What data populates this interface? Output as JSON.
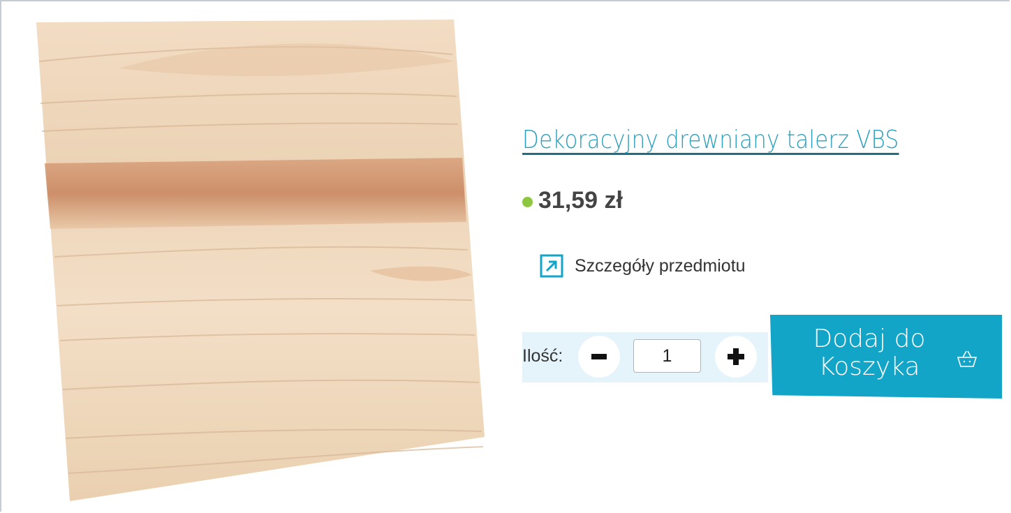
{
  "product": {
    "title": "Dekoracyjny drewniany talerz VBS",
    "price": "31,59 zł",
    "details_link": "Szczegóły przedmiotu",
    "image_icon": "wooden-board-image"
  },
  "cart": {
    "qty_label": "Ilość:",
    "qty_value": "1",
    "minus_icon": "minus-icon",
    "plus_icon": "plus-icon",
    "add_label": "Dodaj do Koszyka",
    "add_icon": "basket-icon"
  },
  "colors": {
    "accent": "#13a5c8",
    "title": "#2a9fbd",
    "availability": "#8dc63f",
    "qty_panel": "#e4f4fa"
  }
}
